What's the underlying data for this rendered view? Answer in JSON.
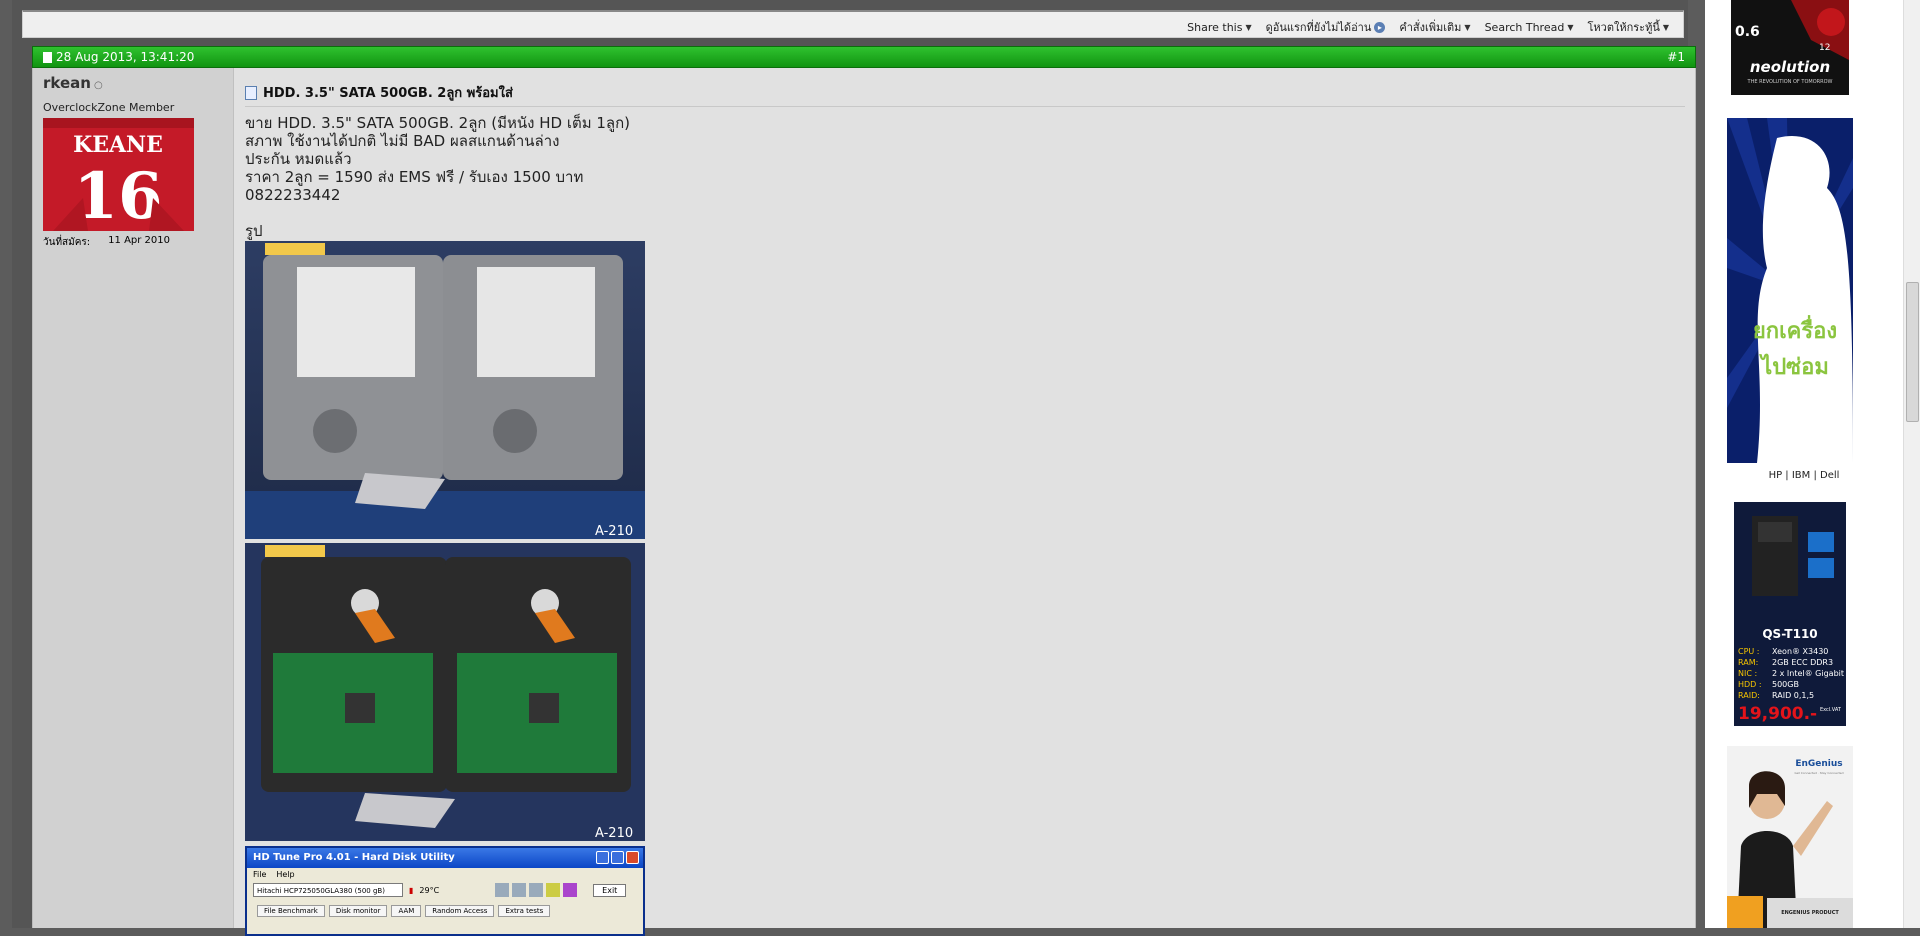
{
  "thread_tools": {
    "share": "Share this",
    "first_unread": "ดูอันแรกที่ยังไม่ได้อ่าน",
    "more_commands": "คำสั่งเพิ่มเติม",
    "search_thread": "Search Thread",
    "view_mode": "โหวตให้กระทู้นี้"
  },
  "post": {
    "date": "28 Aug 2013, 13:41:20",
    "number": "#1",
    "username": "rkean",
    "online_status": "○",
    "user_title": "OverclockZone Member",
    "avatar_text_top": "KEANE",
    "avatar_text_num": "16",
    "join_label": "วันที่สมัคร:",
    "join_date": "11 Apr 2010",
    "title": "HDD. 3.5\" SATA 500GB. 2ลูก พร้อมใส่",
    "body": [
      "ขาย HDD. 3.5\" SATA 500GB. 2ลูก (มีหนัง HD เต็ม 1ลูก)",
      "สภาพ ใช้งานได้ปกติ ไม่มี BAD ผลสแกนด้านล่าง",
      "ประกัน หมดแล้ว",
      "ราคา 2ลูก = 1590 ส่ง EMS ฟรี / รับเอง 1500 บาท",
      "0822233442"
    ],
    "pic_label": "รูป",
    "photo1_caption": "A-210",
    "photo2_caption": "A-210"
  },
  "hdtune": {
    "title": "HD Tune Pro 4.01 - Hard Disk Utility",
    "menu_file": "File",
    "menu_help": "Help",
    "drive": "Hitachi HCP725050GLA380 (500 gB)",
    "temp": "29°C",
    "exit": "Exit",
    "tabs": [
      "File Benchmark",
      "Disk monitor",
      "AAM",
      "Random Access",
      "Extra tests"
    ]
  },
  "sidebar": {
    "ad1_text": "neolution",
    "ad1_sub": "THE REVOLUTION OF TOMORROW",
    "ad1_badge1": "0.6",
    "ad1_badge2": "12",
    "ad2_line1": "ยกเครื่อง",
    "ad2_line2": "ไปซ่อม",
    "links": "HP | IBM | Dell",
    "ad3_model": "QS-T110",
    "ad3_specs": [
      {
        "k": "CPU :",
        "v": "Xeon® X3430"
      },
      {
        "k": "RAM:",
        "v": "2GB ECC DDR3"
      },
      {
        "k": "NIC :",
        "v": "2 x Intel® Gigabit"
      },
      {
        "k": "HDD :",
        "v": "500GB"
      },
      {
        "k": "RAID:",
        "v": "RAID 0,1,5"
      }
    ],
    "ad3_price": "19,900.-",
    "ad3_vat": "Excl.VAT",
    "ad4_brand": "EnGenius",
    "ad4_sub": "Get Connected · Stay Connected",
    "ad4_footer": "ENGENIUS PRODUCT"
  }
}
